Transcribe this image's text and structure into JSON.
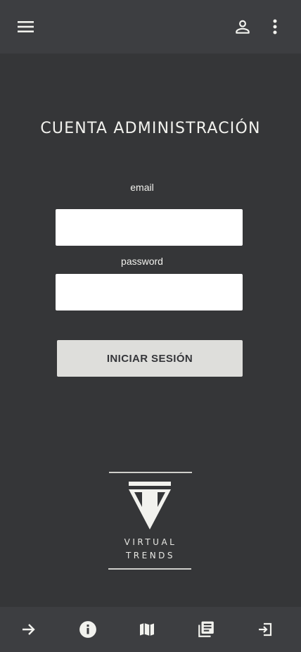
{
  "header": {
    "menu_icon": "menu-icon",
    "account_icon": "account-icon",
    "more_icon": "more-vert-icon"
  },
  "login": {
    "title": "CUENTA ADMINISTRACIÓN",
    "email_label": "email",
    "email_value": "",
    "password_label": "password",
    "password_value": "",
    "submit_label": "INICIAR SESIÓN"
  },
  "logo": {
    "line1": "VIRTUAL",
    "line2": "TRENDS"
  },
  "bottom_nav": {
    "items": [
      {
        "icon": "arrow-forward-icon"
      },
      {
        "icon": "info-icon"
      },
      {
        "icon": "map-icon"
      },
      {
        "icon": "library-books-icon"
      },
      {
        "icon": "exit-icon"
      }
    ]
  },
  "colors": {
    "background": "#353638",
    "bar": "#3d3e41",
    "text": "#f2f2ee",
    "button": "#dededb"
  }
}
